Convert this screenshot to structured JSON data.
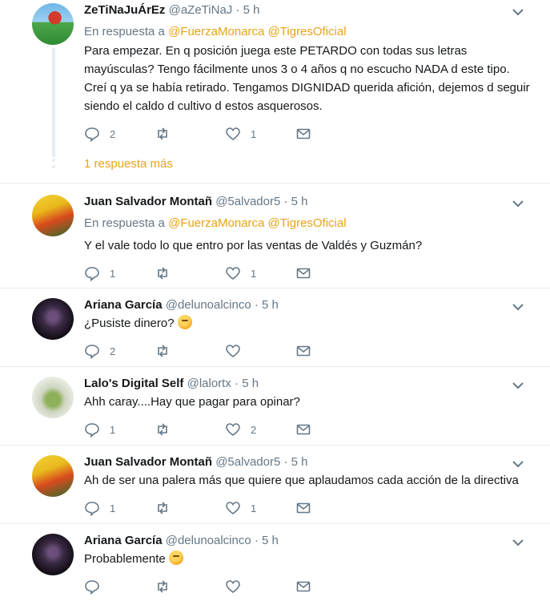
{
  "tweets": [
    {
      "name": "ZeTiNaJuÁrEz",
      "handle": "@aZeTiNaJ",
      "time": "· 5 h",
      "reply_prefix": "En respuesta a",
      "mention1": "@FuerzaMonarca",
      "mention2": "@TigresOficial",
      "text": "Para empezar. En q posición juega este PETARDO con todas sus letras mayúsculas? Tengo fácilmente unos 3 o 4 años q no escucho NADA d este tipo. Creí q ya se había retirado. Tengamos DIGNIDAD querida afición, dejemos d seguir siendo el caldo d cultivo d estos asquerosos.",
      "replies": "2",
      "retweets": "",
      "likes": "1"
    },
    {
      "name": "Juan Salvador Montañ",
      "handle": "@5alvador5",
      "time": "· 5 h",
      "reply_prefix": "En respuesta a",
      "mention1": "@FuerzaMonarca",
      "mention2": "@TigresOficial",
      "text": "Y el vale todo lo que entro por las ventas de Valdés y Guzmán?",
      "replies": "1",
      "retweets": "",
      "likes": "1"
    },
    {
      "name": "Ariana García",
      "handle": "@delunoalcinco",
      "time": "· 5 h",
      "text": "¿Pusiste dinero?",
      "replies": "2",
      "retweets": "",
      "likes": ""
    },
    {
      "name": "Lalo's Digital Self",
      "handle": "@lalortx",
      "time": "· 5 h",
      "text": "Ahh caray....Hay que pagar para opinar?",
      "replies": "1",
      "retweets": "",
      "likes": "2"
    },
    {
      "name": "Juan Salvador Montañ",
      "handle": "@5alvador5",
      "time": "· 5 h",
      "text": "Ah de ser una palera más que quiere que aplaudamos cada acción de la directiva",
      "replies": "1",
      "retweets": "",
      "likes": "1"
    },
    {
      "name": "Ariana García",
      "handle": "@delunoalcinco",
      "time": "· 5 h",
      "text": "Probablemente",
      "replies": "",
      "retweets": "",
      "likes": ""
    }
  ],
  "more_replies": "1 respuesta más",
  "icons": {
    "reply": "reply-icon",
    "retweet": "retweet-icon",
    "like": "heart-icon",
    "dm": "envelope-icon",
    "menu": "chevron-down-icon",
    "emoji": "thinking-face-emoji"
  },
  "colors": {
    "accent": "#e8a317",
    "muted": "#657786",
    "text": "#14171a",
    "divider": "#e6ecf0"
  }
}
